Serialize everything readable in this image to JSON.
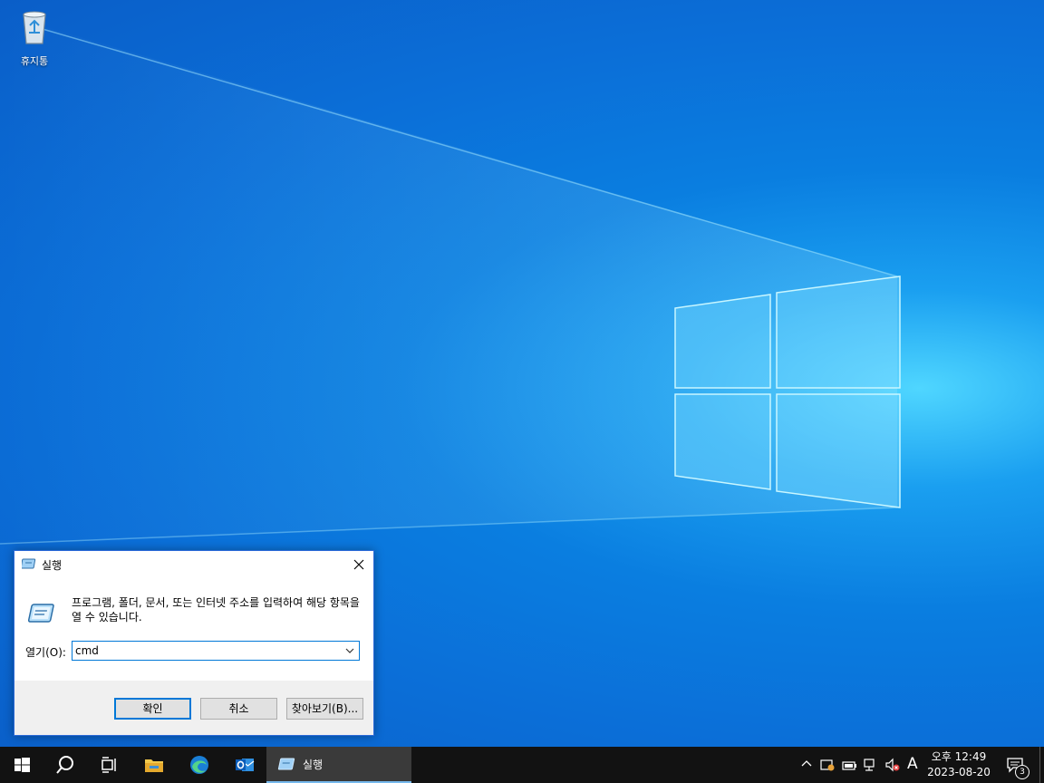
{
  "desktop": {
    "icons": [
      {
        "label": "휴지통",
        "icon": "recycle-bin-icon"
      }
    ]
  },
  "run_dialog": {
    "title": "실행",
    "description": "프로그램, 폴더, 문서, 또는 인터넷 주소를 입력하여 해당 항목을 열 수 있습니다.",
    "open_label": "열기(O):",
    "input_value": "cmd",
    "buttons": {
      "ok": "확인",
      "cancel": "취소",
      "browse": "찾아보기(B)..."
    }
  },
  "taskbar": {
    "pinned": [
      "start-icon",
      "search-icon",
      "task-view-icon",
      "file-explorer-icon",
      "edge-icon",
      "outlook-icon"
    ],
    "active_app": "실행",
    "tray": {
      "time_period": "오후 12:49",
      "date": "2023-08-20",
      "ime": "A",
      "notification_count": "3"
    }
  },
  "colors": {
    "taskbar_bg": "#121212",
    "accent": "#0078d7",
    "desktop_blue": "#0a7ee0"
  }
}
